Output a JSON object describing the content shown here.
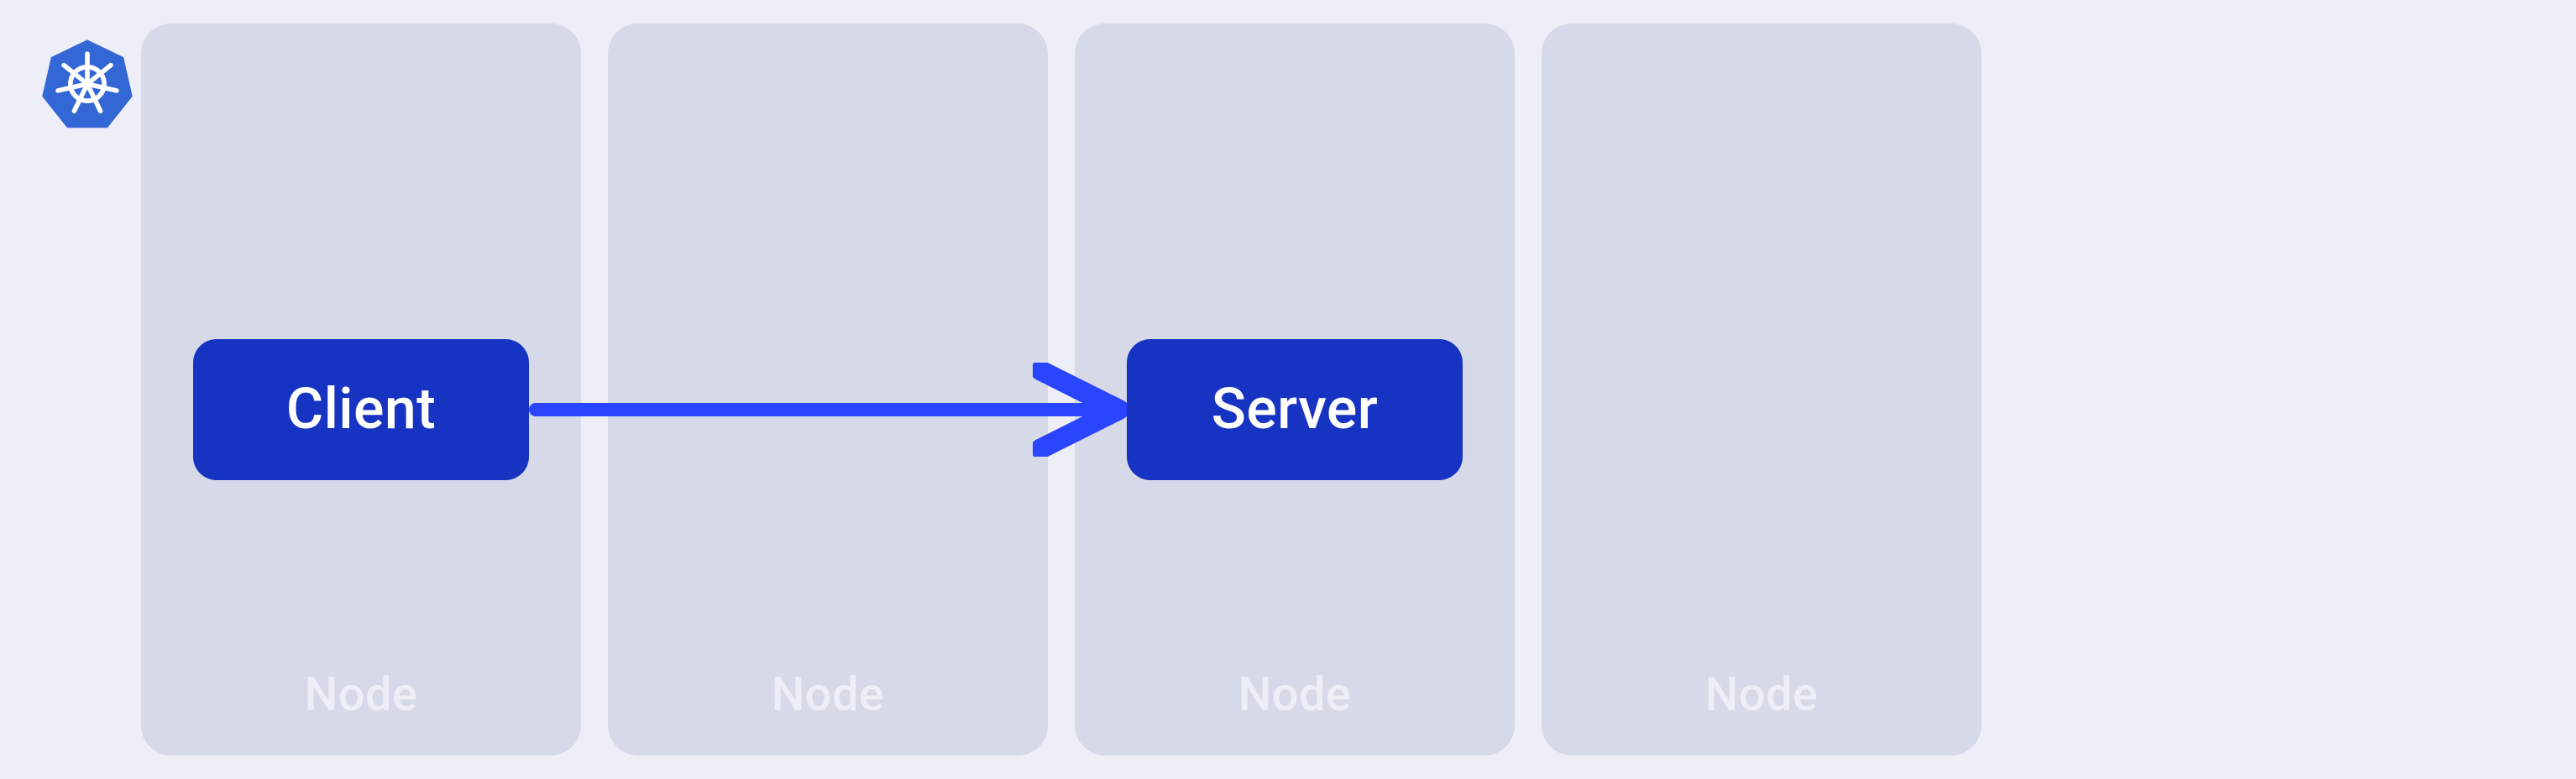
{
  "icon": "kubernetes",
  "nodes": [
    {
      "label": "Node",
      "badge": "Client"
    },
    {
      "label": "Node",
      "badge": null
    },
    {
      "label": "Node",
      "badge": "Server"
    },
    {
      "label": "Node",
      "badge": null
    }
  ],
  "arrow": {
    "from": 0,
    "to": 2,
    "color": "#2a45ff"
  },
  "colors": {
    "page_bg": "#edeef7",
    "node_bg": "#d6d9e8",
    "node_label": "#edeef7",
    "badge_bg": "#1733c2",
    "badge_text": "#ffffff",
    "k8s_blue": "#3467d6"
  }
}
